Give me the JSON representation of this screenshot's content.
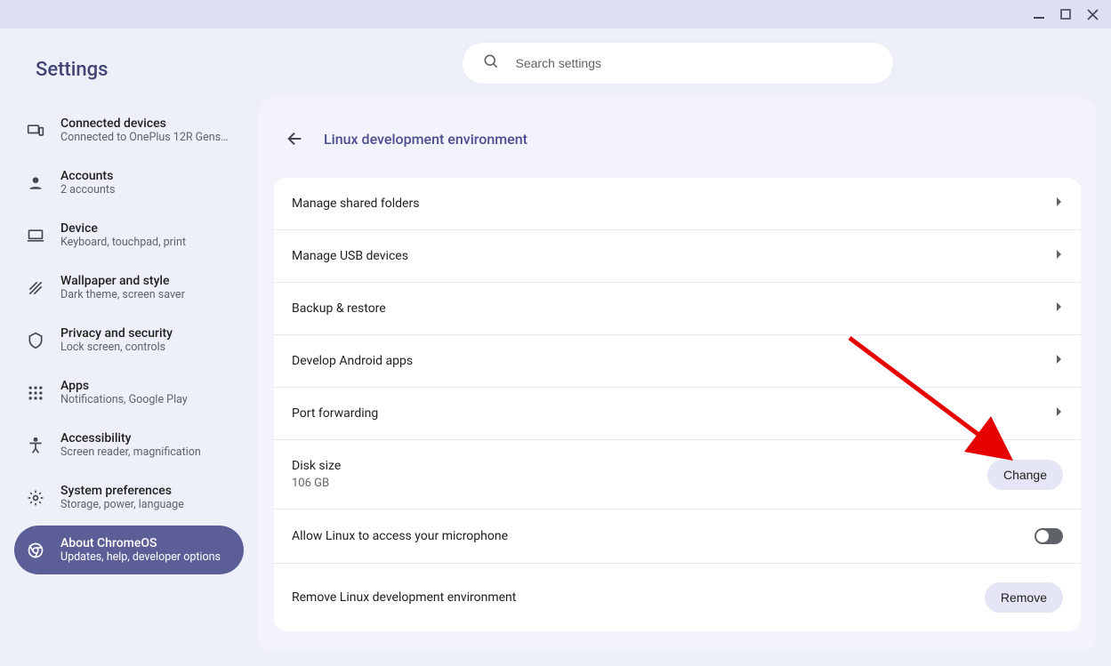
{
  "app_title": "Settings",
  "search": {
    "placeholder": "Search settings"
  },
  "sidebar": {
    "items": [
      {
        "title": "Connected devices",
        "sub": "Connected to OnePlus 12R Gens…"
      },
      {
        "title": "Accounts",
        "sub": "2 accounts"
      },
      {
        "title": "Device",
        "sub": "Keyboard, touchpad, print"
      },
      {
        "title": "Wallpaper and style",
        "sub": "Dark theme, screen saver"
      },
      {
        "title": "Privacy and security",
        "sub": "Lock screen, controls"
      },
      {
        "title": "Apps",
        "sub": "Notifications, Google Play"
      },
      {
        "title": "Accessibility",
        "sub": "Screen reader, magnification"
      },
      {
        "title": "System preferences",
        "sub": "Storage, power, language"
      },
      {
        "title": "About ChromeOS",
        "sub": "Updates, help, developer options"
      }
    ]
  },
  "page": {
    "title": "Linux development environment",
    "rows": {
      "shared_folders": "Manage shared folders",
      "usb_devices": "Manage USB devices",
      "backup_restore": "Backup & restore",
      "android_apps": "Develop Android apps",
      "port_forwarding": "Port forwarding",
      "disk_size_label": "Disk size",
      "disk_size_value": "106 GB",
      "disk_size_button": "Change",
      "microphone": "Allow Linux to access your microphone",
      "remove_label": "Remove Linux development environment",
      "remove_button": "Remove"
    }
  }
}
